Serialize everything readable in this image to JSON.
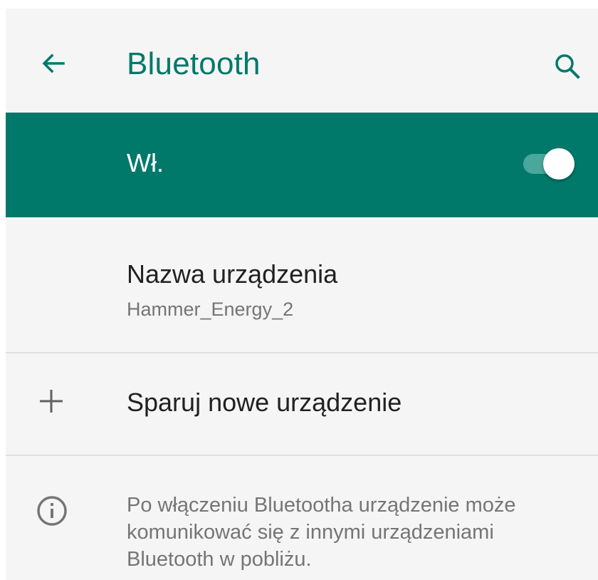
{
  "appbar": {
    "title": "Bluetooth",
    "back_icon": "arrow-back-icon",
    "search_icon": "search-icon"
  },
  "master_switch": {
    "label": "Wł.",
    "state": "on"
  },
  "device_name": {
    "title": "Nazwa urządzenia",
    "value": "Hammer_Energy_2"
  },
  "pair_new": {
    "icon": "plus-icon",
    "label": "Sparuj nowe urządzenie"
  },
  "info": {
    "icon": "info-icon",
    "text": "Po włączeniu Bluetootha urządzenie może komunikować się z innymi urządzeniami Bluetooth w pobliżu."
  },
  "colors": {
    "accent": "#00796b",
    "background": "#f5f5f5",
    "primary_text": "#212121",
    "secondary_text": "#757575"
  }
}
